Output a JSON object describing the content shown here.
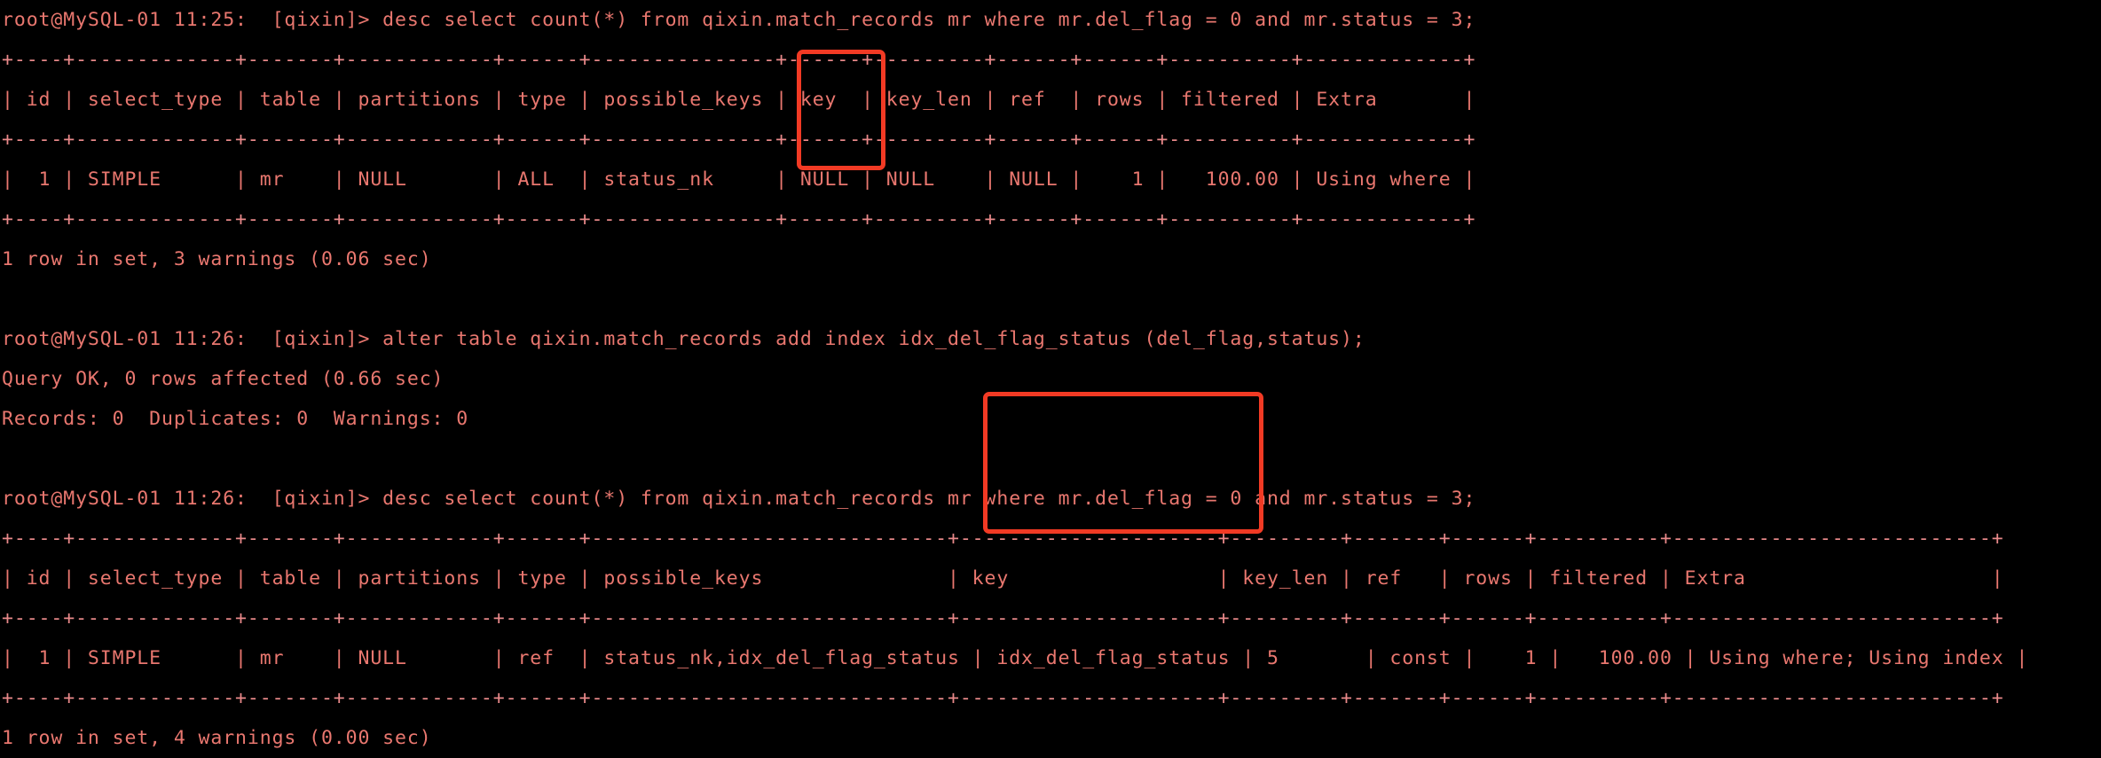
{
  "terminal": {
    "background_color": "#000000",
    "text_color": "#e9776f",
    "rule_color": "#e9898a",
    "highlight_color": "#f23a24",
    "title": "root@MySQL-01 — mysql client"
  },
  "prompts": {
    "user_host": "root@MySQL-01",
    "database": "qixin"
  },
  "annotations": {
    "box_1_target": "key column (first EXPLAIN, value NULL)",
    "box_2_target": "key column (second EXPLAIN, value idx_del_flag_status)"
  },
  "blocks": [
    {
      "name": "first-explain",
      "prompt": "root@MySQL-01 11:25:  [qixin]> ",
      "command": "desc select count(*) from qixin.match_records mr where mr.del_flag = 0 and mr.status = 3;",
      "result_summary": "1 row in set, 3 warnings (0.06 sec)",
      "table": {
        "separator": "+----+-------------+-------+------------+------+---------------+------+---------+------+------+----------+-------------+",
        "header_row": "| id | select_type | table | partitions | type | possible_keys | key  | key_len | ref  | rows | filtered | Extra       |",
        "data_row": "|  1 | SIMPLE      | mr    | NULL       | ALL  | status_nk     | NULL | NULL    | NULL |    1 |   100.00 | Using where |",
        "columns": [
          "id",
          "select_type",
          "table",
          "partitions",
          "type",
          "possible_keys",
          "key",
          "key_len",
          "ref",
          "rows",
          "filtered",
          "Extra"
        ],
        "values": [
          "1",
          "SIMPLE",
          "mr",
          "NULL",
          "ALL",
          "status_nk",
          "NULL",
          "NULL",
          "NULL",
          "1",
          "100.00",
          "Using where"
        ]
      }
    },
    {
      "name": "alter-table",
      "prompt": "root@MySQL-01 11:26:  [qixin]> ",
      "command": "alter table qixin.match_records add index idx_del_flag_status (del_flag,status);",
      "output_line_1": "Query OK, 0 rows affected (0.66 sec)",
      "output_line_2": "Records: 0  Duplicates: 0  Warnings: 0"
    },
    {
      "name": "second-explain",
      "prompt": "root@MySQL-01 11:26:  [qixin]> ",
      "command": "desc select count(*) from qixin.match_records mr where mr.del_flag = 0 and mr.status = 3;",
      "result_summary": "1 row in set, 4 warnings (0.00 sec)",
      "table": {
        "separator": "+----+-------------+-------+------------+------+-----------------------------+---------------------+---------+-------+------+----------+--------------------------+",
        "header_row": "| id | select_type | table | partitions | type | possible_keys               | key                 | key_len | ref   | rows | filtered | Extra                    |",
        "data_row": "|  1 | SIMPLE      | mr    | NULL       | ref  | status_nk,idx_del_flag_status | idx_del_flag_status | 5       | const |    1 |   100.00 | Using where; Using index |",
        "columns": [
          "id",
          "select_type",
          "table",
          "partitions",
          "type",
          "possible_keys",
          "key",
          "key_len",
          "ref",
          "rows",
          "filtered",
          "Extra"
        ],
        "values": [
          "1",
          "SIMPLE",
          "mr",
          "NULL",
          "ref",
          "status_nk,idx_del_flag_status",
          "idx_del_flag_status",
          "5",
          "const",
          "1",
          "100.00",
          "Using where; Using index"
        ]
      }
    }
  ],
  "lines": [
    {
      "id": "l01",
      "kind": "cmd",
      "text": "root@MySQL-01 11:25:  [qixin]> desc select count(*) from qixin.match_records mr where mr.del_flag = 0 and mr.status = 3;"
    },
    {
      "id": "l02",
      "kind": "rule",
      "text": "+----+-------------+-------+------------+------+---------------+------+---------+------+------+----------+-------------+"
    },
    {
      "id": "l03",
      "kind": "cmd",
      "text": "| id | select_type | table | partitions | type | possible_keys | key  | key_len | ref  | rows | filtered | Extra       |"
    },
    {
      "id": "l04",
      "kind": "rule",
      "text": "+----+-------------+-------+------------+------+---------------+------+---------+------+------+----------+-------------+"
    },
    {
      "id": "l05",
      "kind": "cmd",
      "text": "|  1 | SIMPLE      | mr    | NULL       | ALL  | status_nk     | NULL | NULL    | NULL |    1 |   100.00 | Using where |"
    },
    {
      "id": "l06",
      "kind": "rule",
      "text": "+----+-------------+-------+------------+------+---------------+------+---------+------+------+----------+-------------+"
    },
    {
      "id": "l07",
      "kind": "cmd",
      "text": "1 row in set, 3 warnings (0.06 sec)"
    },
    {
      "id": "l08",
      "kind": "blank",
      "text": " "
    },
    {
      "id": "l09",
      "kind": "cmd",
      "text": "root@MySQL-01 11:26:  [qixin]> alter table qixin.match_records add index idx_del_flag_status (del_flag,status);"
    },
    {
      "id": "l10",
      "kind": "cmd",
      "text": "Query OK, 0 rows affected (0.66 sec)"
    },
    {
      "id": "l11",
      "kind": "cmd",
      "text": "Records: 0  Duplicates: 0  Warnings: 0"
    },
    {
      "id": "l12",
      "kind": "blank",
      "text": " "
    },
    {
      "id": "l13",
      "kind": "cmd",
      "text": "root@MySQL-01 11:26:  [qixin]> desc select count(*) from qixin.match_records mr where mr.del_flag = 0 and mr.status = 3;"
    },
    {
      "id": "l14",
      "kind": "rule",
      "text": "+----+-------------+-------+------------+------+-----------------------------+---------------------+---------+-------+------+----------+--------------------------+"
    },
    {
      "id": "l15",
      "kind": "cmd",
      "text": "| id | select_type | table | partitions | type | possible_keys               | key                 | key_len | ref   | rows | filtered | Extra                    |"
    },
    {
      "id": "l16",
      "kind": "rule",
      "text": "+----+-------------+-------+------------+------+-----------------------------+---------------------+---------+-------+------+----------+--------------------------+"
    },
    {
      "id": "l17",
      "kind": "cmd",
      "text": "|  1 | SIMPLE      | mr    | NULL       | ref  | status_nk,idx_del_flag_status | idx_del_flag_status | 5       | const |    1 |   100.00 | Using where; Using index |"
    },
    {
      "id": "l18",
      "kind": "rule",
      "text": "+----+-------------+-------+------------+------+-----------------------------+---------------------+---------+-------+------+----------+--------------------------+"
    },
    {
      "id": "l19",
      "kind": "cmd",
      "text": "1 row in set, 4 warnings (0.00 sec)"
    }
  ]
}
